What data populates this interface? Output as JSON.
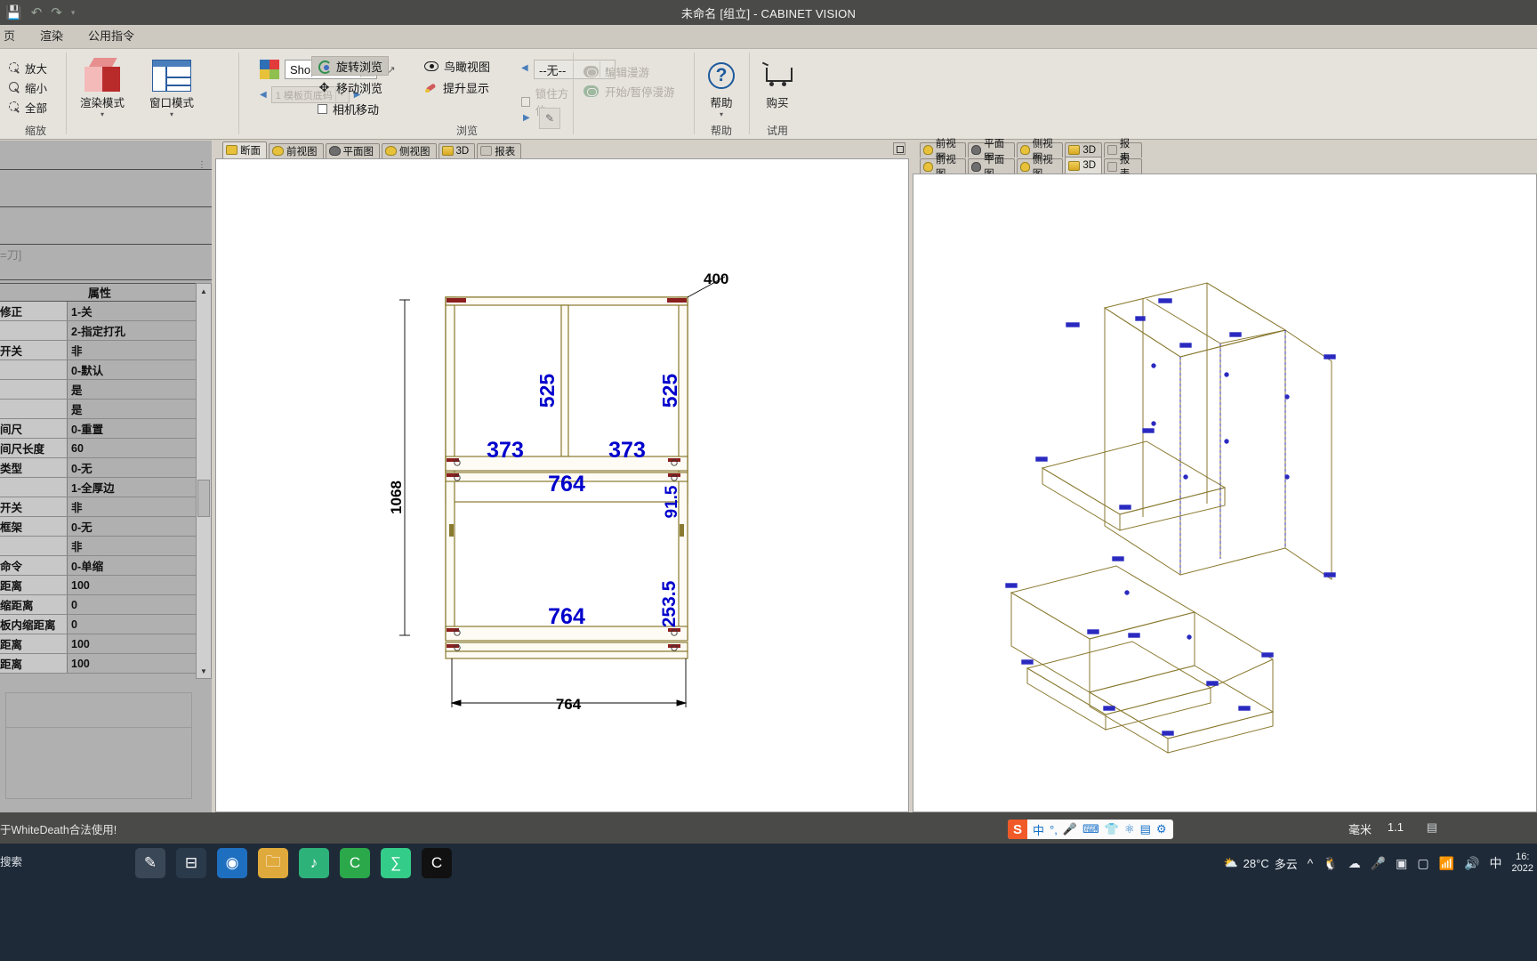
{
  "window": {
    "title": "未命名 [组立] - CABINET VISION",
    "quick_access": [
      "save-icon",
      "undo-icon",
      "redo-icon",
      "customize-icon"
    ]
  },
  "ribbon": {
    "tabs": [
      {
        "label": "页",
        "active": false
      },
      {
        "label": "渲染",
        "active": false
      },
      {
        "label": "公用指令",
        "active": false
      }
    ],
    "groups": {
      "zoom": {
        "caption": "缩放",
        "items": [
          {
            "label": "放大",
            "icon": "zoom-in-icon"
          },
          {
            "label": "缩小",
            "icon": "zoom-out-icon"
          },
          {
            "label": "全部",
            "icon": "zoom-all-icon"
          }
        ]
      },
      "browse": {
        "caption": "浏览",
        "render_mode_label": "渲染模式",
        "window_mode_label": "窗口模式",
        "shop_value": "Shop",
        "page_number_value": "1 模板页底码",
        "nav_buttons": [
          {
            "label": "旋转浏览",
            "active": true,
            "icon": "rotate-icon"
          },
          {
            "label": "移动浏览",
            "active": false,
            "icon": "pan-icon"
          },
          {
            "label": "相机移动",
            "active": false,
            "icon": "checkbox-icon"
          }
        ],
        "nav_buttons2": [
          {
            "label": "鸟瞰视图",
            "active": false,
            "icon": "eye-icon"
          },
          {
            "label": "提升显示",
            "active": false,
            "icon": "rocket-icon"
          }
        ],
        "none_value": "--无--",
        "lock_label": "锁住方位"
      },
      "roam": {
        "caption": "",
        "items": [
          {
            "label": "编辑漫游",
            "disabled": true,
            "icon": "edit-roam-icon"
          },
          {
            "label": "开始/暂停漫游",
            "disabled": true,
            "icon": "play-roam-icon"
          }
        ]
      },
      "help": {
        "caption": "帮助",
        "label": "帮助",
        "icon": "question-mark-icon"
      },
      "trial": {
        "caption": "试用",
        "label": "购买",
        "icon": "shopping-cart-icon"
      }
    }
  },
  "sidebar": {
    "truncated_text": "=刀]",
    "properties_header": "属性",
    "rows": [
      {
        "key": "修正",
        "value": "1-关"
      },
      {
        "key": "",
        "value": "2-指定打孔"
      },
      {
        "key": "开关",
        "value": "非"
      },
      {
        "key": "",
        "value": "0-默认"
      },
      {
        "key": "",
        "value": "是"
      },
      {
        "key": "",
        "value": "是"
      },
      {
        "key": "间尺",
        "value": "0-重置"
      },
      {
        "key": "间尺长度",
        "value": "60"
      },
      {
        "key": "类型",
        "value": "0-无"
      },
      {
        "key": "",
        "value": "1-全厚边"
      },
      {
        "key": "开关",
        "value": "非"
      },
      {
        "key": "框架",
        "value": "0-无"
      },
      {
        "key": "",
        "value": "非"
      },
      {
        "key": "命令",
        "value": "0-单缩"
      },
      {
        "key": "距离",
        "value": "100"
      },
      {
        "key": "缩距离",
        "value": "0"
      },
      {
        "key": "板内缩距离",
        "value": "0"
      },
      {
        "key": "距离",
        "value": "100"
      },
      {
        "key": "距离",
        "value": "100"
      }
    ]
  },
  "left_pane": {
    "tabs": [
      {
        "label": "断面",
        "icon": "section-icon",
        "selected": true
      },
      {
        "label": "前视图",
        "icon": "front-view-icon",
        "selected": false
      },
      {
        "label": "平面图",
        "icon": "plan-view-icon",
        "selected": false
      },
      {
        "label": "侧视图",
        "icon": "side-view-icon",
        "selected": false
      },
      {
        "label": "3D",
        "icon": "3d-view-icon",
        "selected": false
      },
      {
        "label": "报表",
        "icon": "report-icon",
        "selected": false
      }
    ]
  },
  "right_pane": {
    "tabs_top": [
      {
        "label": "前视图",
        "icon": "front-view-icon",
        "selected": false
      },
      {
        "label": "平面图",
        "icon": "plan-view-icon",
        "selected": false
      },
      {
        "label": "侧视图",
        "icon": "side-view-icon",
        "selected": false
      },
      {
        "label": "3D",
        "icon": "3d-view-icon",
        "selected": false
      },
      {
        "label": "报表",
        "icon": "report-icon",
        "selected": false
      }
    ],
    "tabs_bottom": [
      {
        "label": "前视图",
        "icon": "front-view-icon",
        "selected": false
      },
      {
        "label": "平面图",
        "icon": "plan-view-icon",
        "selected": false
      },
      {
        "label": "侧视图",
        "icon": "side-view-icon",
        "selected": false
      },
      {
        "label": "3D",
        "icon": "3d-view-icon",
        "selected": true
      },
      {
        "label": "报表",
        "icon": "report-icon",
        "selected": false
      }
    ]
  },
  "drawing": {
    "dimension_color": "#0000cc",
    "dimensions": {
      "top_leader": "400",
      "left_height": "1068",
      "door_left_height": "525",
      "door_right_height": "525",
      "door_left_width": "373",
      "door_right_width": "373",
      "mid_width": "764",
      "small_right": "91.5",
      "lower_right": "253.5",
      "lower_width": "764",
      "bottom_width": "764"
    }
  },
  "status_bar": {
    "license": "于WhiteDeath合法使用!",
    "units": "毫米",
    "scale": "1.1"
  },
  "ime": {
    "logo": "S",
    "items": [
      "中",
      "°,",
      "mic-icon",
      "keyboard-icon",
      "shirt-icon",
      "robot-icon",
      "apps-icon",
      "android-icon"
    ]
  },
  "taskbar": {
    "search_placeholder": "搜索",
    "apps": [
      {
        "name": "pen-tools-icon",
        "glyph": "✎"
      },
      {
        "name": "task-view-icon",
        "glyph": "⊟"
      },
      {
        "name": "edge-icon",
        "glyph": "◉"
      },
      {
        "name": "file-explorer-icon",
        "glyph": "🗀"
      },
      {
        "name": "music-app-icon",
        "glyph": "♪"
      },
      {
        "name": "green-app-icon",
        "glyph": "C"
      },
      {
        "name": "chart-app-icon",
        "glyph": "∑"
      },
      {
        "name": "capcut-icon",
        "glyph": "C"
      }
    ],
    "weather_temp": "28°C",
    "weather_desc": "多云",
    "tray": [
      "chevron-up-icon",
      "qq-icon",
      "cloud-icon",
      "mic-icon",
      "screenshot-icon",
      "display-icon",
      "wifi-icon",
      "volume-icon",
      "ime-cn-icon"
    ],
    "clock_time": "16:",
    "clock_date": "2022"
  }
}
